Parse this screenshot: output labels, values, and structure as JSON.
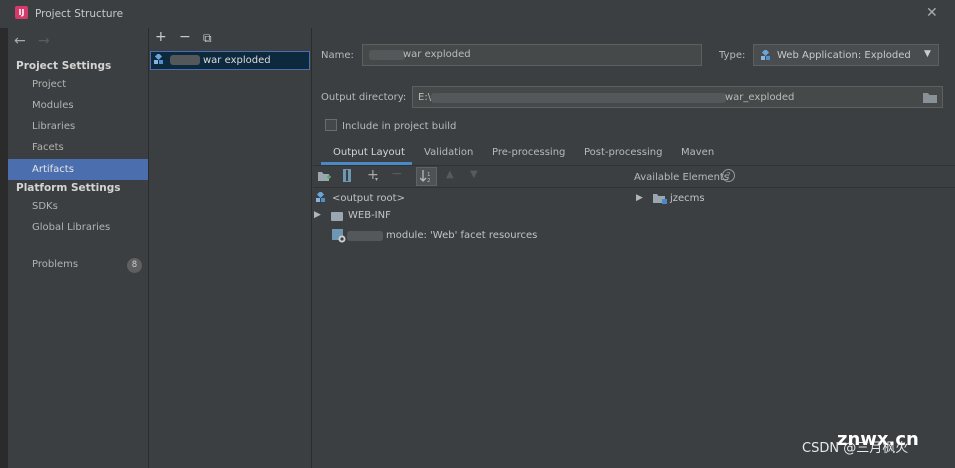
{
  "window": {
    "title": "Project Structure",
    "app_letters": "IJ"
  },
  "nav": {
    "back": "←",
    "forward": "→"
  },
  "sidebar": {
    "project_settings_heading": "Project Settings",
    "project_items": [
      {
        "label": "Project"
      },
      {
        "label": "Modules"
      },
      {
        "label": "Libraries"
      },
      {
        "label": "Facets"
      },
      {
        "label": "Artifacts",
        "selected": true
      }
    ],
    "platform_settings_heading": "Platform Settings",
    "platform_items": [
      {
        "label": "SDKs"
      },
      {
        "label": "Global Libraries"
      }
    ],
    "problems_label": "Problems",
    "problems_count": "8"
  },
  "artifact_list": {
    "toolbar": {
      "add": "+",
      "remove": "−",
      "copy": "⧉"
    },
    "items": [
      {
        "label": "war exploded"
      }
    ]
  },
  "details": {
    "name_label": "Name:",
    "name_value": "war exploded",
    "type_label": "Type:",
    "type_value": "Web Application: Exploded",
    "output_dir_label": "Output directory:",
    "output_dir_prefix": "E:\\",
    "output_dir_suffix": "war_exploded",
    "include_in_build_label": "Include in project build",
    "include_in_build_checked": false,
    "tabs": [
      {
        "label": "Output Layout",
        "active": true
      },
      {
        "label": "Validation"
      },
      {
        "label": "Pre-processing"
      },
      {
        "label": "Post-processing"
      },
      {
        "label": "Maven"
      }
    ],
    "layout_tree": [
      {
        "label": "<output root>"
      },
      {
        "label": "WEB-INF"
      },
      {
        "label": "module: 'Web' facet resources"
      }
    ],
    "available_elements_label": "Available Elements",
    "available_items": [
      {
        "label": "jzecms"
      }
    ]
  },
  "watermark": {
    "text": "CSDN @三月枫火",
    "brand": "znwx.cn"
  },
  "colors": {
    "selection": "#4b6eaf",
    "background": "#3c3f41",
    "tab_underline": "#4a88c7"
  }
}
